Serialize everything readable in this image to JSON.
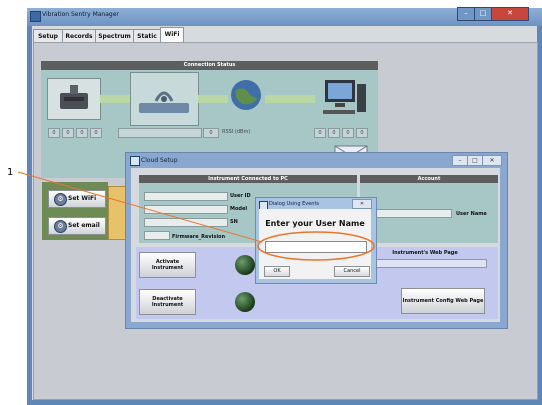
{
  "window": {
    "title": "Vibration Sentry Manager",
    "controls": [
      "–",
      "□",
      "✕"
    ]
  },
  "tabs": [
    {
      "label": "Setup"
    },
    {
      "label": "Records"
    },
    {
      "label": "Spectrum"
    },
    {
      "label": "Static"
    },
    {
      "label": "WiFi"
    }
  ],
  "active_tab": "WiFi",
  "connection": {
    "title": "Connection Status",
    "ip_boxes_left": [
      "0",
      "0",
      "0",
      "0"
    ],
    "signal_value": "0",
    "rssi_label": "RSSI (dBm)",
    "ip_boxes_right": [
      "0",
      "0",
      "0",
      "0"
    ]
  },
  "side_buttons": {
    "set_wifi": "Set WiFi",
    "set_email": "Set email"
  },
  "cloud": {
    "title": "Cloud Setup",
    "instrument_header": "Instrument Connected to PC",
    "account_header": "Account",
    "fields": {
      "user_id": "User ID",
      "model": "Model",
      "sn": "SN",
      "firmware": "Firmware_Revision"
    },
    "user_name_label": "User Name",
    "web_page_header": "Instrument's Web Page",
    "activate": "Activate Instrument",
    "deactivate": "Deactivate Instrument",
    "config_web": "Instrument Config Web Page",
    "window_controls": [
      "–",
      "□",
      "✕"
    ]
  },
  "dialog": {
    "title": "Dialog Using Events",
    "message": "Enter your User Name",
    "input_value": "",
    "ok": "OK",
    "cancel": "Cancel",
    "close": "✕"
  },
  "annotation": {
    "number": "1"
  },
  "colors": {
    "accent_orange": "#e8762e",
    "titlebar": "#6d93c1",
    "panel_teal": "#a7c6c6",
    "panel_blue": "#c3c8ee",
    "header_gray": "#5e5e5e"
  },
  "icons": [
    "app-icon",
    "device-icon",
    "router-icon",
    "globe-icon",
    "computer-icon",
    "email-icon",
    "wifi-gear-icon",
    "email-gear-icon",
    "led-indicator"
  ]
}
